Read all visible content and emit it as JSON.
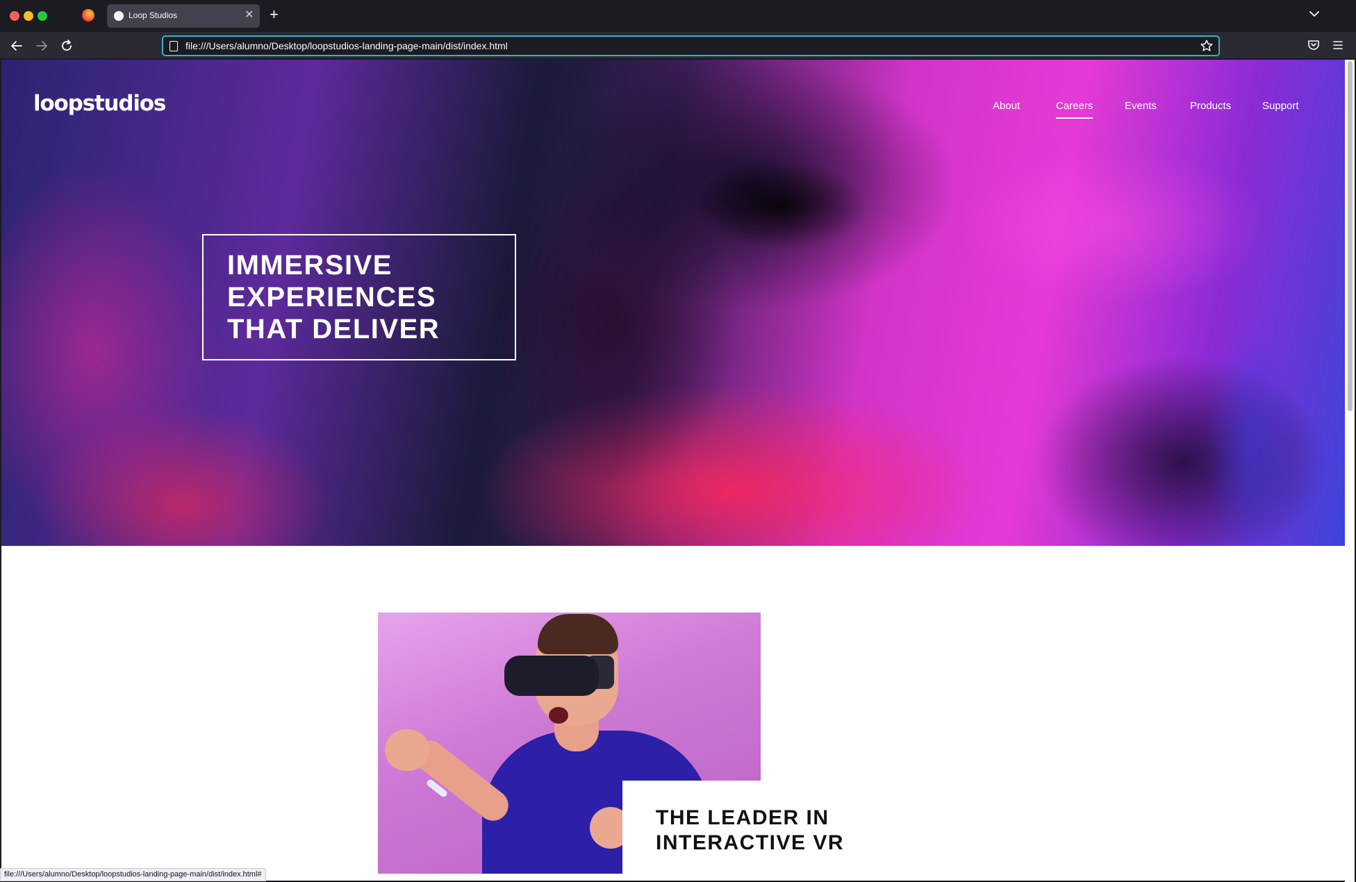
{
  "browser": {
    "tab_title": "Loop Studios",
    "url": "file:///Users/alumno/Desktop/loopstudios-landing-page-main/dist/index.html",
    "status_url": "file:///Users/alumno/Desktop/loopstudios-landing-page-main/dist/index.html#",
    "new_tab_label": "+",
    "tab_close_label": "✕",
    "accent_color": "#2fb6c1"
  },
  "site": {
    "logo": "loopstudios",
    "nav": [
      {
        "label": "About",
        "active": false
      },
      {
        "label": "Careers",
        "active": true
      },
      {
        "label": "Events",
        "active": false
      },
      {
        "label": "Products",
        "active": false
      },
      {
        "label": "Support",
        "active": false
      }
    ],
    "hero_title": "IMMERSIVE EXPERIENCES THAT DELIVER",
    "section_title": "THE LEADER IN INTERACTIVE VR"
  },
  "icons": [
    "firefox-icon",
    "back-icon",
    "forward-icon",
    "reload-icon",
    "page-icon",
    "bookmark-star-icon",
    "pocket-icon",
    "menu-icon",
    "tab-list-chevron-icon"
  ]
}
